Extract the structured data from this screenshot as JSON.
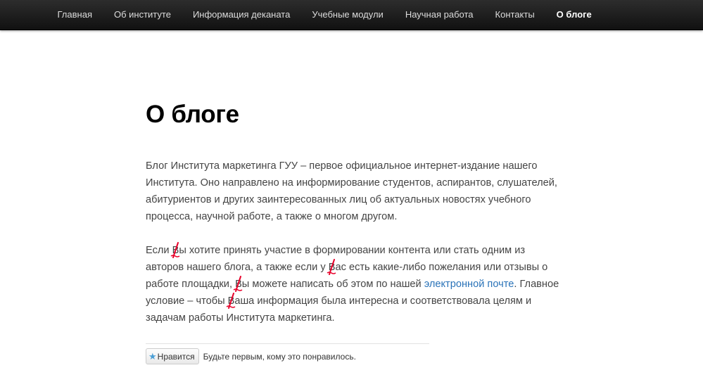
{
  "nav": {
    "items": [
      {
        "label": "Главная"
      },
      {
        "label": "Об институте"
      },
      {
        "label": "Информация деканата"
      },
      {
        "label": "Учебные модули"
      },
      {
        "label": "Научная работа"
      },
      {
        "label": "Контакты"
      },
      {
        "label": "О блоге",
        "active": true
      }
    ]
  },
  "page": {
    "title": "О блоге",
    "paragraph1": "Блог Института маркетинга ГУУ – первое официальное интернет-издание нашего Института. Оно направлено на информирование студентов, аспирантов, слушателей, абитуриентов и других заинтересованных лиц об актуальных новостях учебного процесса,  научной работе, а также о многом другом.",
    "paragraph2": {
      "t1": "Если ",
      "w1": "Вы",
      "t2": " хотите принять участие в формировании контента или стать одним из авторов нашего блога, а также если у ",
      "w2": "Вас",
      "t3": " есть какие-либо пожелания или отзывы о работе площадки, ",
      "w3": "Вы",
      "t4": " можете написать об этом по нашей ",
      "link": "электронной почте",
      "t5": ". Главное условие –  чтобы ",
      "w4": "Ваша",
      "t6": " информация была интересна и соответствовала целям и задачам работы Института маркетинга."
    }
  },
  "like": {
    "button_label": "Нравится",
    "text": "Будьте первым, кому это понравилось."
  },
  "icons": {
    "star": "star-icon",
    "typo_mark": "red-strike-mark"
  },
  "colors": {
    "navbar": "#1a1a1a",
    "link": "#2a73b8",
    "typo_mark": "#e8002a",
    "body_text": "#444444"
  }
}
